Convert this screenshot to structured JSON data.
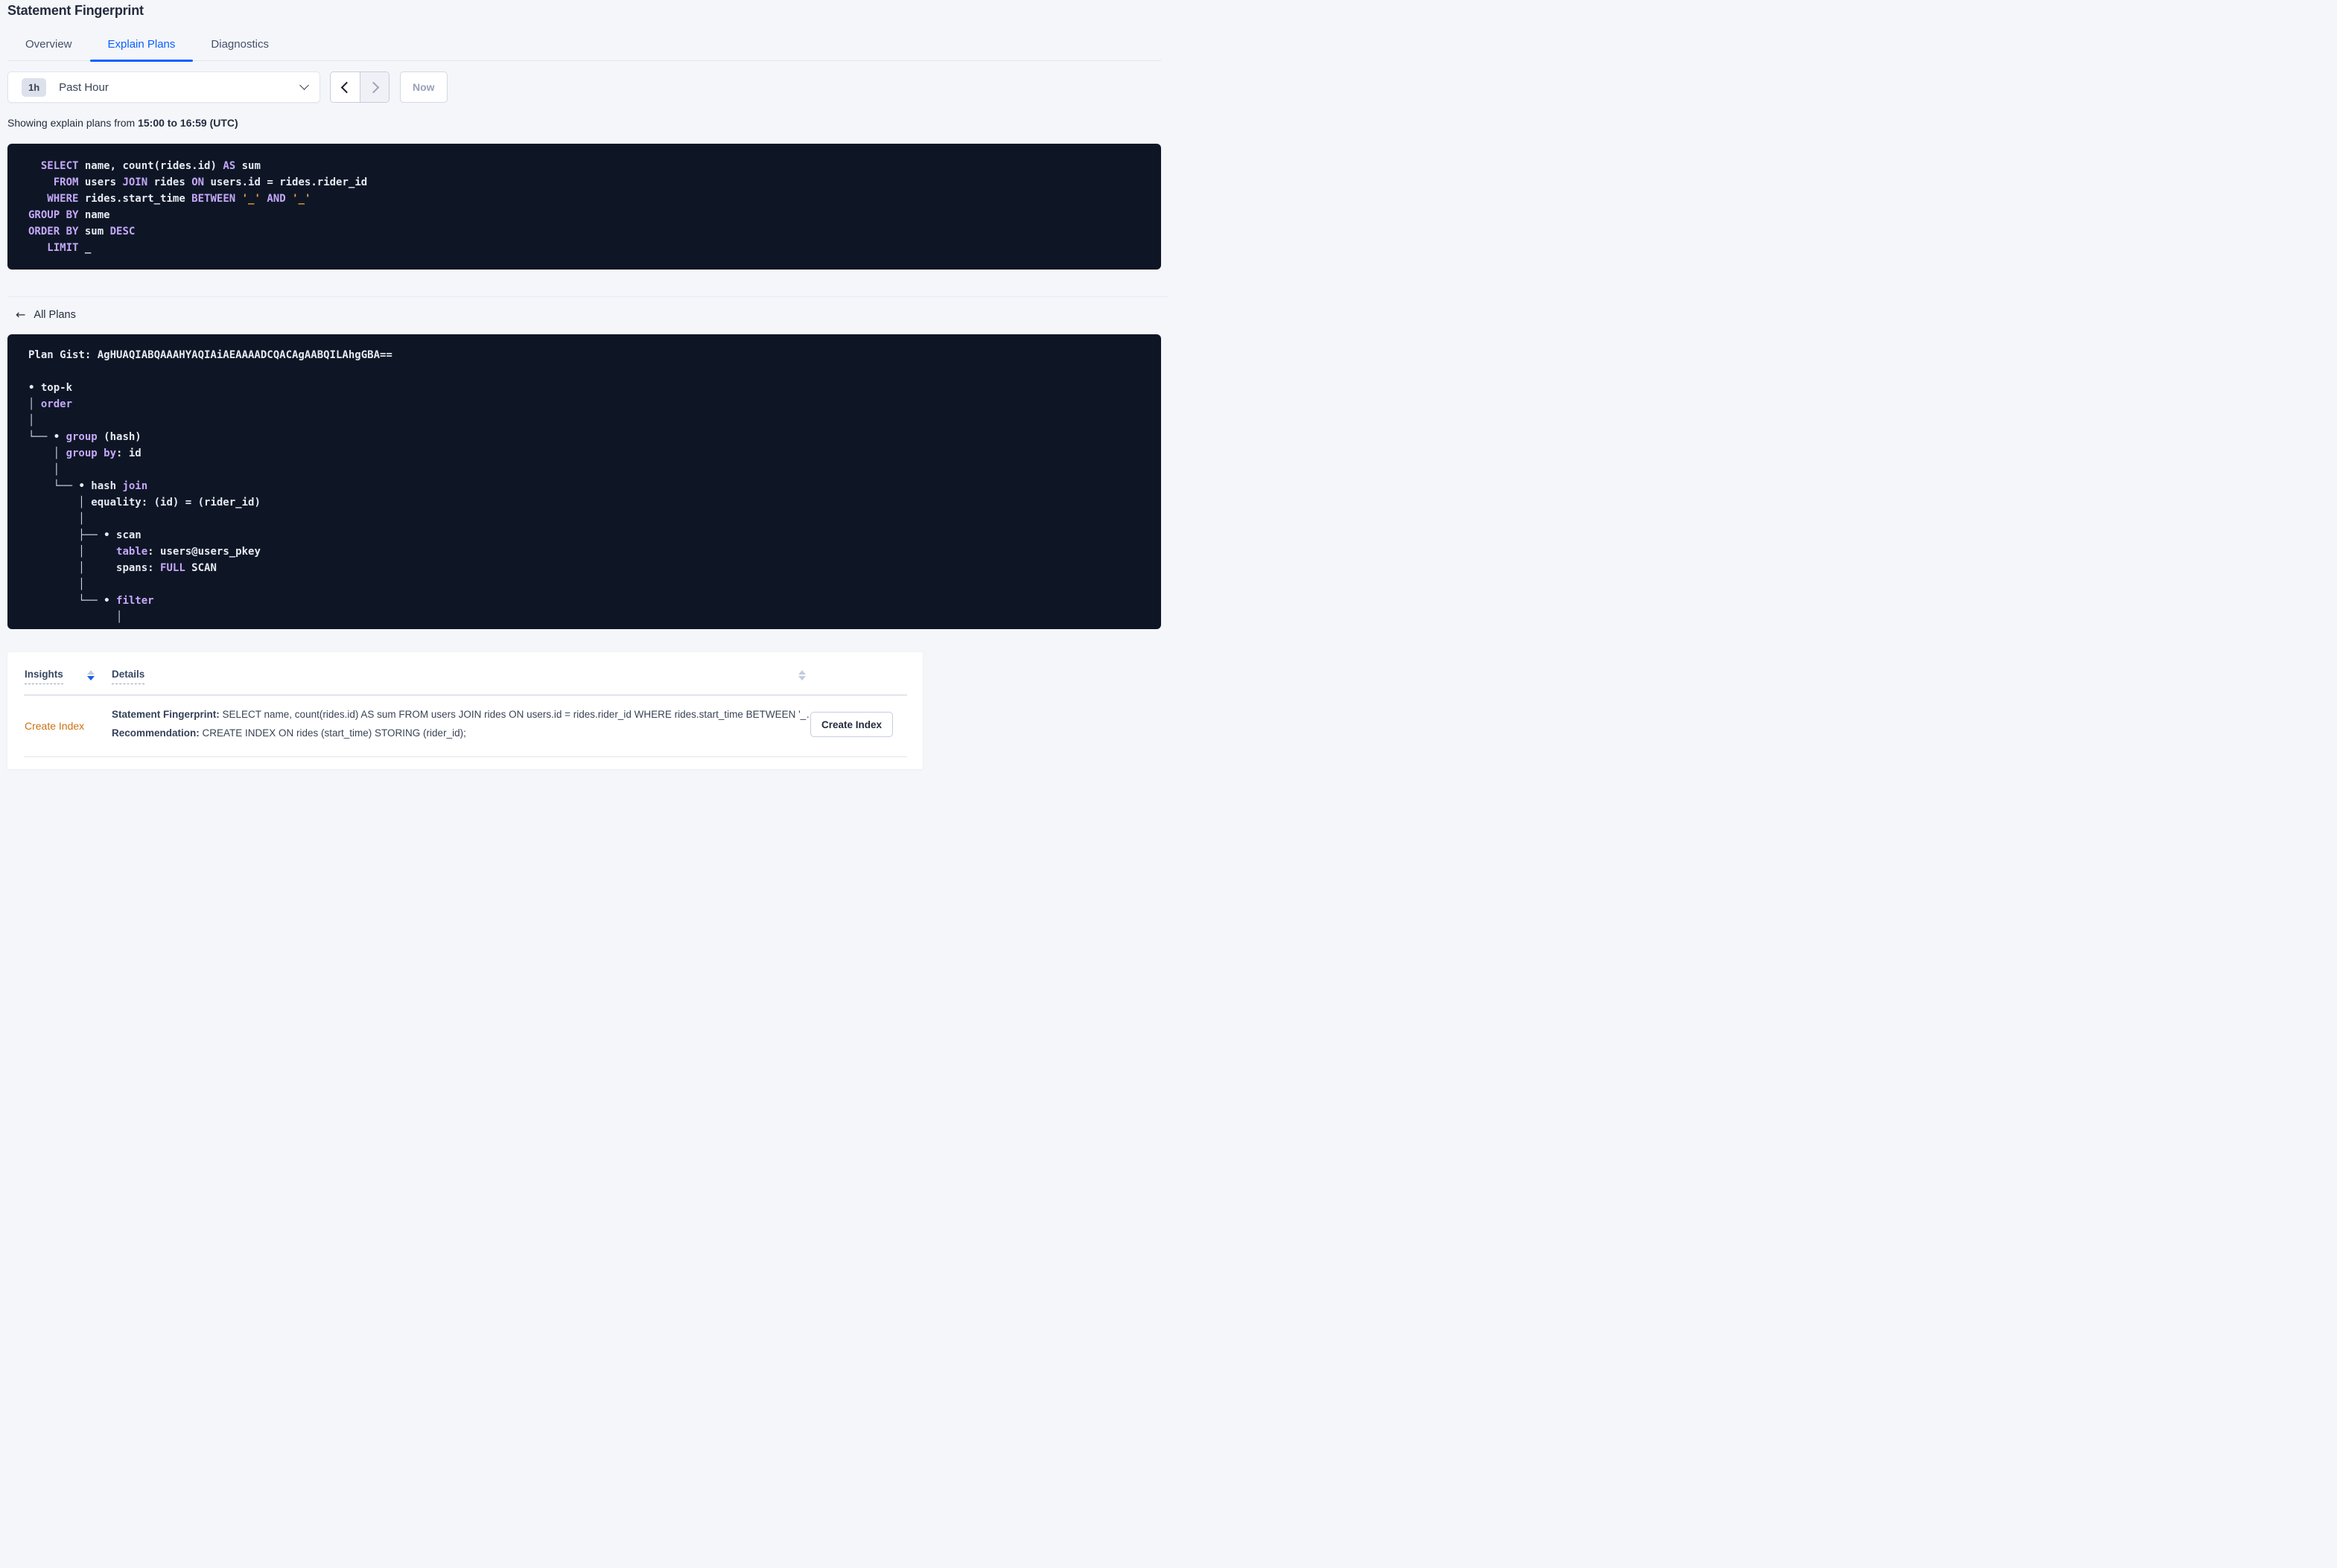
{
  "page": {
    "title": "Statement Fingerprint"
  },
  "tabs": [
    {
      "label": "Overview",
      "active": false
    },
    {
      "label": "Explain Plans",
      "active": true
    },
    {
      "label": "Diagnostics",
      "active": false
    }
  ],
  "time_picker": {
    "badge": "1h",
    "label": "Past Hour",
    "now_label": "Now",
    "prev_enabled": true,
    "next_enabled": false
  },
  "showing": {
    "prefix": "Showing explain plans from ",
    "range": "15:00 to 16:59 (UTC)"
  },
  "sql": {
    "lines": [
      [
        [
          "id",
          "  "
        ],
        [
          "kw",
          "SELECT"
        ],
        [
          "id",
          " name, count(rides.id) "
        ],
        [
          "kw",
          "AS"
        ],
        [
          "id",
          " sum"
        ]
      ],
      [
        [
          "id",
          "    "
        ],
        [
          "kw",
          "FROM"
        ],
        [
          "id",
          " users "
        ],
        [
          "kw",
          "JOIN"
        ],
        [
          "id",
          " rides "
        ],
        [
          "kw",
          "ON"
        ],
        [
          "id",
          " users.id = rides.rider_id"
        ]
      ],
      [
        [
          "id",
          "   "
        ],
        [
          "kw",
          "WHERE"
        ],
        [
          "id",
          " rides.start_time "
        ],
        [
          "kw",
          "BETWEEN"
        ],
        [
          "id",
          " "
        ],
        [
          "lit",
          "'_'"
        ],
        [
          "id",
          " "
        ],
        [
          "kw",
          "AND"
        ],
        [
          "id",
          " "
        ],
        [
          "lit",
          "'_'"
        ]
      ],
      [
        [
          "kw",
          "GROUP BY"
        ],
        [
          "id",
          " name"
        ]
      ],
      [
        [
          "kw",
          "ORDER BY"
        ],
        [
          "id",
          " sum "
        ],
        [
          "kw",
          "DESC"
        ]
      ],
      [
        [
          "id",
          "   "
        ],
        [
          "kw",
          "LIMIT"
        ],
        [
          "id",
          " _"
        ]
      ]
    ]
  },
  "all_plans": {
    "label": "All Plans",
    "arrow": "←"
  },
  "plan": {
    "gist": "AgHUAQIABQAAAHYAQIAiAEAAAADCQACAgAABQILAhgGBA==",
    "lines": [
      [
        [
          "id",
          "Plan Gist: AgHUAQIABQAAAHYAQIAiAEAAAADCQACAgAABQILAhgGBA=="
        ]
      ],
      [],
      [
        [
          "id",
          "• top-k"
        ]
      ],
      [
        [
          "tr",
          "│ "
        ],
        [
          "kw",
          "order"
        ]
      ],
      [
        [
          "tr",
          "│"
        ]
      ],
      [
        [
          "tr",
          "└── "
        ],
        [
          "id",
          "• "
        ],
        [
          "kw",
          "group"
        ],
        [
          "id",
          " (hash)"
        ]
      ],
      [
        [
          "tr",
          "    │ "
        ],
        [
          "kw",
          "group by"
        ],
        [
          "id",
          ": id"
        ]
      ],
      [
        [
          "tr",
          "    │"
        ]
      ],
      [
        [
          "tr",
          "    └── "
        ],
        [
          "id",
          "• hash "
        ],
        [
          "kw",
          "join"
        ]
      ],
      [
        [
          "tr",
          "        │ "
        ],
        [
          "id",
          "equality: (id) = (rider_id)"
        ]
      ],
      [
        [
          "tr",
          "        │"
        ]
      ],
      [
        [
          "tr",
          "        ├── "
        ],
        [
          "id",
          "• scan"
        ]
      ],
      [
        [
          "tr",
          "        │     "
        ],
        [
          "kw",
          "table"
        ],
        [
          "id",
          ": users@users_pkey"
        ]
      ],
      [
        [
          "tr",
          "        │     "
        ],
        [
          "id",
          "spans: "
        ],
        [
          "kw",
          "FULL"
        ],
        [
          "id",
          " SCAN"
        ]
      ],
      [
        [
          "tr",
          "        │"
        ]
      ],
      [
        [
          "tr",
          "        └── "
        ],
        [
          "id",
          "• "
        ],
        [
          "kw",
          "filter"
        ]
      ],
      [
        [
          "tr",
          "              │"
        ]
      ]
    ]
  },
  "table": {
    "columns": [
      {
        "label": "Insights",
        "sort": "desc"
      },
      {
        "label": "Details",
        "sort": "none"
      }
    ],
    "rows": [
      {
        "insight": "Create Index",
        "details": [
          {
            "label": "Statement Fingerprint:",
            "text": " SELECT name, count(rides.id) AS sum FROM users JOIN rides ON users.id = rides.rider_id WHERE rides.start_time BETWEEN '_…"
          },
          {
            "label": "Recommendation:",
            "text": " CREATE INDEX ON rides (start_time) STORING (rider_id);"
          }
        ],
        "action_label": "Create Index"
      }
    ]
  },
  "colors": {
    "accent_blue": "#0B5FFF",
    "code_background": "#0E1626",
    "keyword_purple": "#C5A8F8",
    "code_text": "#E6EAF1",
    "literal_orange": "#EFA13C",
    "insight_orange": "#C87314"
  }
}
